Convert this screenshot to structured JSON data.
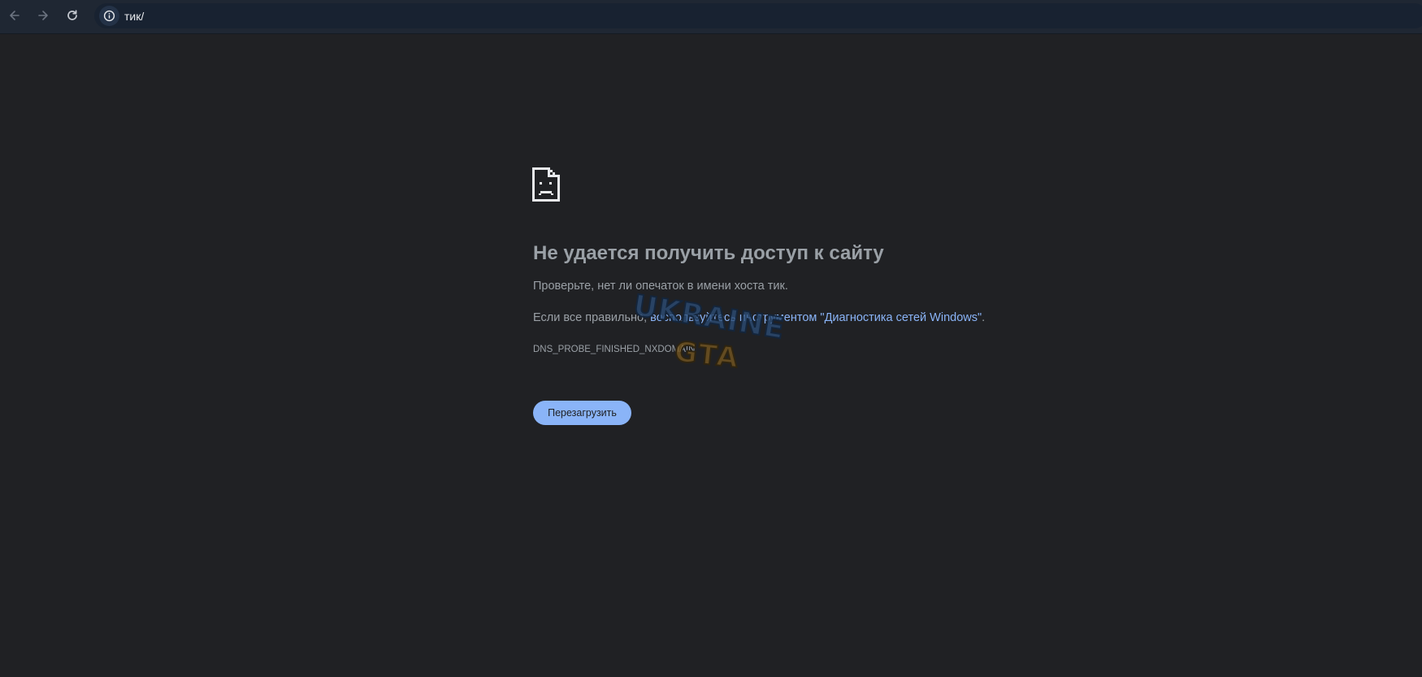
{
  "browser": {
    "back_icon": "arrow-left-icon",
    "forward_icon": "arrow-right-icon",
    "reload_icon": "reload-icon",
    "site_info_icon": "info-circle-icon",
    "url": "тик/"
  },
  "error_page": {
    "icon": "sad-document-icon",
    "title": "Не удается получить доступ к сайту",
    "line1": "Проверьте, нет ли опечаток в имени хоста тик.",
    "line2_prefix": "Если все правильно, ",
    "line2_link": "воспользуйтесь инструментом \"Диагностика сетей Windows\"",
    "line2_suffix": ".",
    "error_code": "DNS_PROBE_FINISHED_NXDOMAIN",
    "reload_button": "Перезагрузить"
  },
  "watermark": {
    "line1": "UKRAINE",
    "line2": "GTA"
  },
  "colors": {
    "page_bg": "#202124",
    "toolbar_bg": "#1f2733",
    "text": "#9aa0a6",
    "link": "#8ab4f8",
    "button_bg": "#8ab4f8"
  }
}
